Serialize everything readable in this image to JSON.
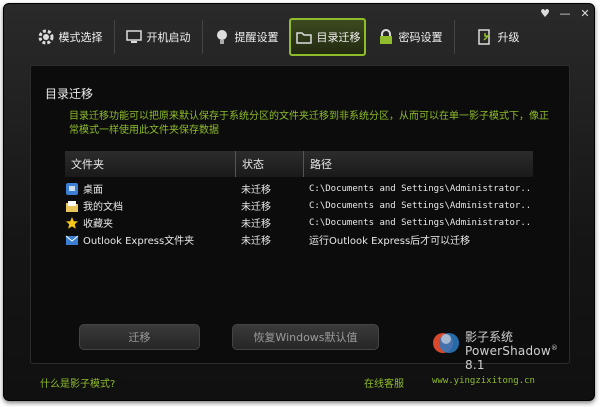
{
  "window": {
    "controls": {
      "pin": "♥",
      "minimize": "—",
      "close": "✕"
    }
  },
  "tabs": [
    {
      "label": "模式选择",
      "icon": "gear-icon",
      "active": false
    },
    {
      "label": "开机启动",
      "icon": "monitor-icon",
      "active": false
    },
    {
      "label": "提醒设置",
      "icon": "lightbulb-icon",
      "active": false
    },
    {
      "label": "目录迁移",
      "icon": "folder-icon",
      "active": true
    },
    {
      "label": "密码设置",
      "icon": "lock-icon",
      "active": false
    },
    {
      "label": "升级",
      "icon": "upgrade-icon",
      "active": false
    }
  ],
  "panel": {
    "title": "目录迁移",
    "description": "目录迁移功能可以把原来默认保存于系统分区的文件夹迁移到非系统分区，从而可以在单一影子模式下，像正常模式一样使用此文件夹保存数据"
  },
  "table": {
    "headers": {
      "folder": "文件夹",
      "status": "状态",
      "path": "路径"
    },
    "rows": [
      {
        "folder": "桌面",
        "icon": "desktop-icon",
        "status": "未迁移",
        "path": "C:\\Documents and Settings\\Administrator..."
      },
      {
        "folder": "我的文档",
        "icon": "documents-icon",
        "status": "未迁移",
        "path": "C:\\Documents and Settings\\Administrator..."
      },
      {
        "folder": "收藏夹",
        "icon": "star-icon",
        "status": "未迁移",
        "path": "C:\\Documents and Settings\\Administrator..."
      },
      {
        "folder": "Outlook Express文件夹",
        "icon": "outlook-icon",
        "status": "未迁移",
        "path": "运行Outlook Express后才可以迁移"
      }
    ]
  },
  "buttons": {
    "move": "迁移",
    "restore": "恢复Windows默认值"
  },
  "brand": {
    "name": "影子系统",
    "product": "PowerShadow",
    "version": "8.1",
    "registered": "®"
  },
  "footer": {
    "what_is": "什么是影子模式?",
    "support": "在线客服",
    "website": "www.yingzixitong.cn"
  },
  "colors": {
    "accent": "#8ebc2a",
    "background": "#141414"
  }
}
